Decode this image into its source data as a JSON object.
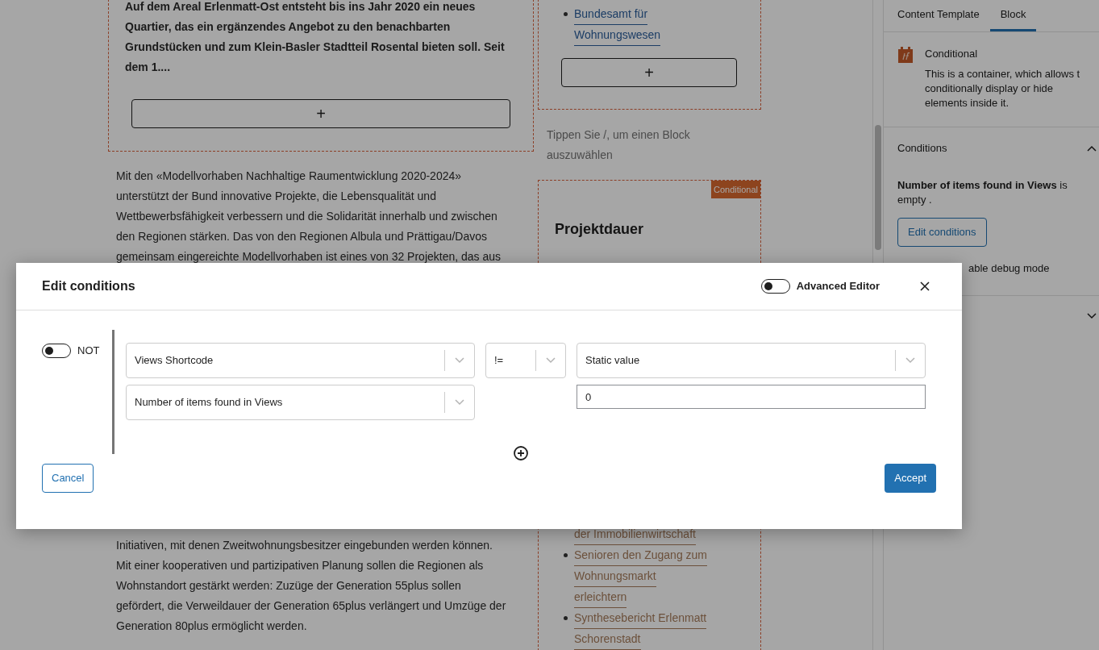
{
  "editor": {
    "left_column": {
      "intro_block": {
        "text": "Auf dem Areal Erlenmatt-Ost entsteht bis ins Jahr 2020 ein neues Quartier, das ein ergänzendes Angebot zu den benachbarten Grundstücken und zum Klein-Basler Stadtteil Rosental bieten soll. Seit dem 1....",
        "add_button": "+"
      },
      "paragraph_top": [
        "Mit den «Modellvorhaben Nachhaltige Raumentwicklung 2020-2024»",
        "unterstützt der Bund innovative Projekte, die Lebensqualität und",
        "Wettbewerbsfähigkeit verbessern und die Solidarität innerhalb und zwischen",
        "den Regionen stärken. Das von den Regionen Albula und Prättigau/Davos",
        "gemeinsam eingereichte Modellvorhaben ist eines von 32 Projekten, das aus"
      ],
      "paragraph_bottom": [
        "Initiativen, mit denen Zweitwohnungsbesitzer eingebunden werden können.",
        "Mit einer kooperativen und partizipativen Planung sollen die Regionen als",
        "Wohnstandort gestärkt werden: Zuzüge der Generation 55plus sollen",
        "gefördert, die Verweildauer der Generation 65plus verlängert und Umzüge der",
        "Generation 80plus ermöglicht werden."
      ]
    },
    "right_column": {
      "links_top": [
        {
          "lines": [
            "Bundesamt für",
            "Wohnungswesen"
          ],
          "visited": false,
          "continued": false
        }
      ],
      "add_button": "+",
      "placeholder": [
        "Tippen Sie /, um einen Block",
        "auszuwählen"
      ],
      "conditional_block": {
        "badge": "Conditional",
        "heading": "Projektdauer"
      },
      "links_bottom": [
        {
          "lines": [
            "der Immobilienwirtschaft"
          ],
          "visited": true,
          "continued": true
        },
        {
          "lines": [
            "Senioren den Zugang zum",
            "Wohnungsmarkt",
            "erleichtern"
          ],
          "visited": true,
          "continued": false
        },
        {
          "lines": [
            "Synthesebericht Erlenmatt",
            "Schorenstadt"
          ],
          "visited": true,
          "continued": false
        }
      ]
    }
  },
  "sidebar": {
    "tabs": [
      {
        "label": "Content Template",
        "selected": false
      },
      {
        "label": "Block",
        "selected": true
      }
    ],
    "block_card": {
      "title": "Conditional",
      "description": [
        "This is a container, which allows t",
        "conditionally display or hide",
        "elements inside it."
      ]
    },
    "conditions": {
      "title": "Conditions",
      "expanded": true,
      "summary": "**Number of items found in Views** is empty .",
      "button": "Edit conditions",
      "debug_label": "able debug mode"
    },
    "collapsed_panel": {
      "expanded": false
    }
  },
  "dialog": {
    "title": "Edit conditions",
    "advanced_editor": {
      "label": "Advanced Editor",
      "on": false
    },
    "not_toggle": {
      "label": "NOT",
      "on": false
    },
    "condition": {
      "source": "Views Shortcode",
      "field": "Number of items found in Views",
      "operator": "!=",
      "value_type": "Static value",
      "value": "0"
    },
    "cancel": "Cancel",
    "accept": "Accept"
  }
}
